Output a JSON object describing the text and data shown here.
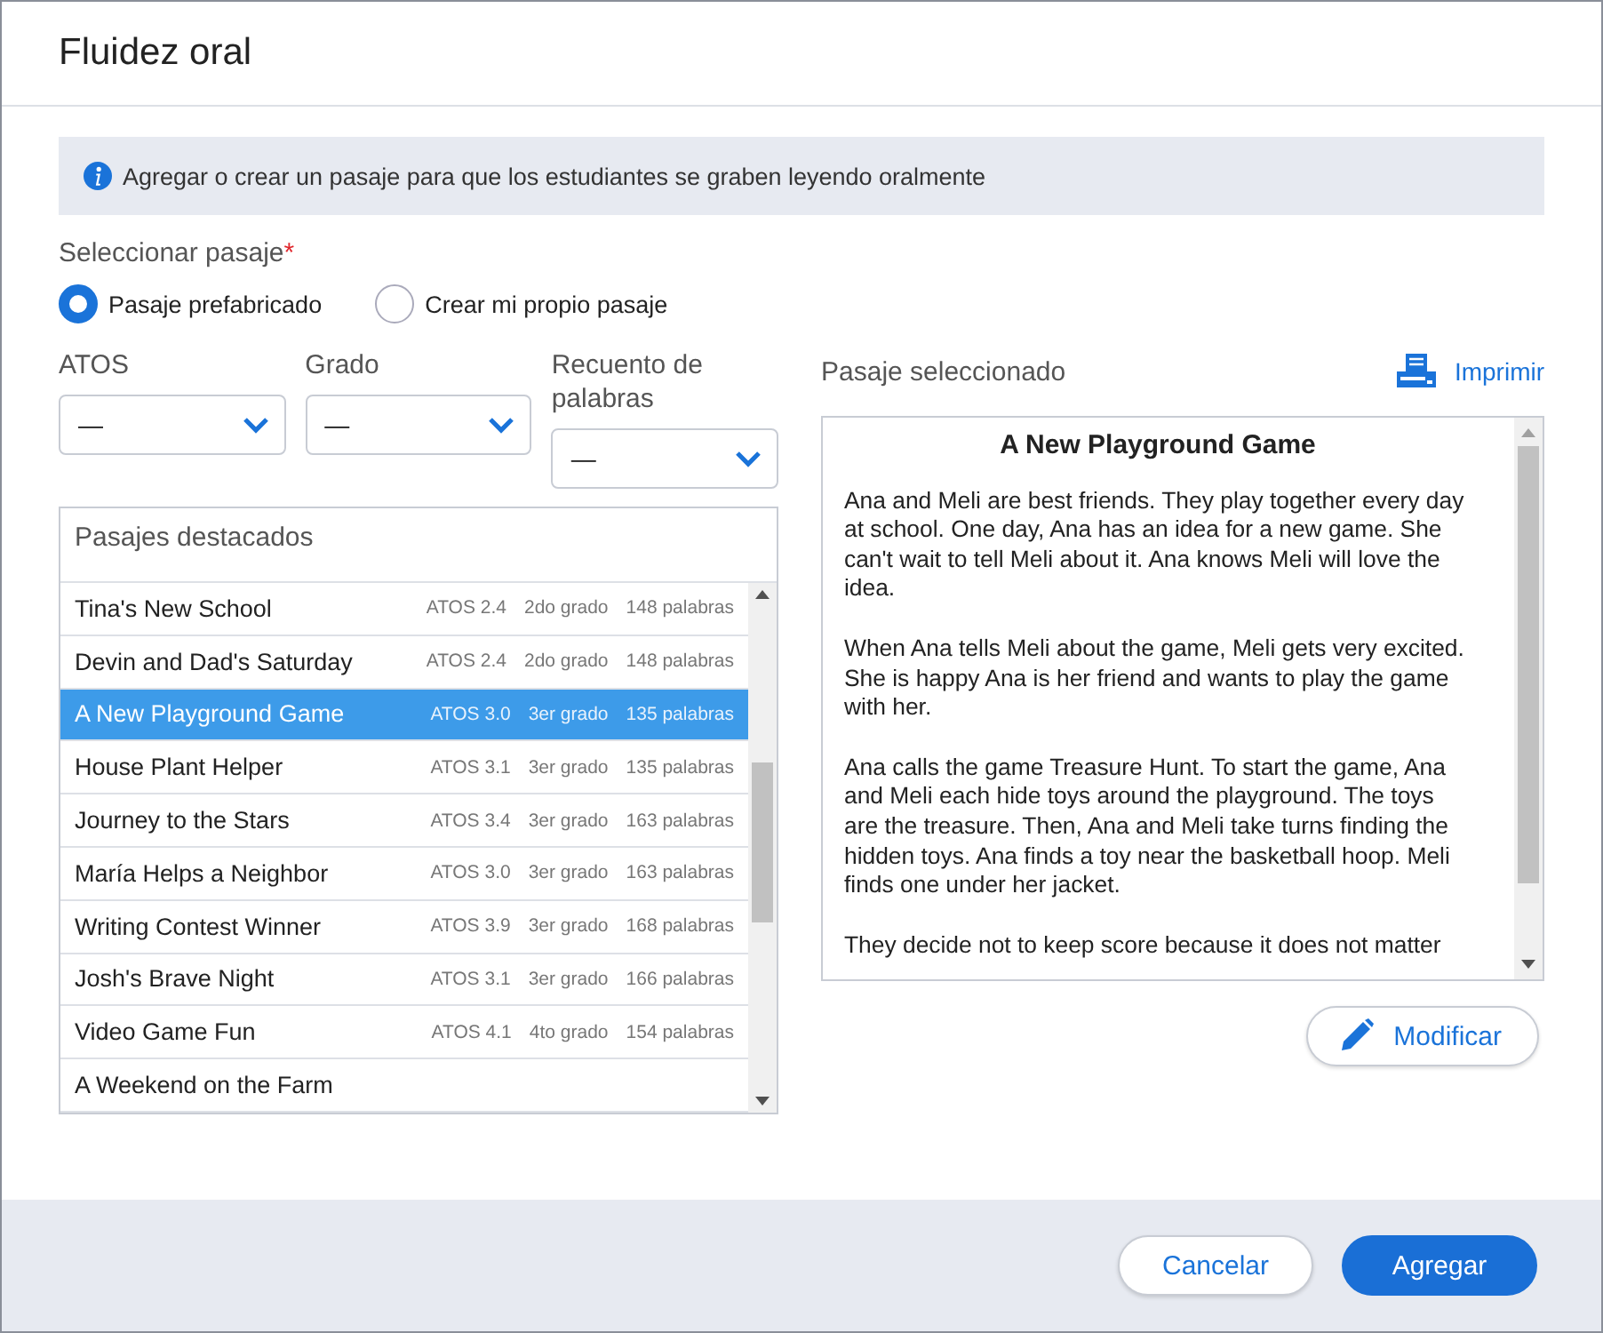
{
  "dialog": {
    "title": "Fluidez oral"
  },
  "info_banner": {
    "text": "Agregar o crear un pasaje para que los estudiantes se graben leyendo oralmente"
  },
  "passage_select": {
    "label": "Seleccionar pasaje",
    "required_mark": "*",
    "options": [
      {
        "label": "Pasaje prefabricado",
        "selected": true
      },
      {
        "label": "Crear mi propio pasaje",
        "selected": false
      }
    ]
  },
  "filters": [
    {
      "label": "ATOS",
      "value": "—"
    },
    {
      "label": "Grado",
      "value": "—"
    },
    {
      "label": "Recuento de palabras",
      "value": "—"
    }
  ],
  "featured_list": {
    "header": "Pasajes destacados",
    "rows": [
      {
        "title": "Tina's New School",
        "atos": "ATOS 2.4",
        "grade": "2do grado",
        "words": "148 palabras",
        "selected": false
      },
      {
        "title": "Devin and Dad's Saturday",
        "atos": "ATOS 2.4",
        "grade": "2do grado",
        "words": "148 palabras",
        "selected": false
      },
      {
        "title": "A New Playground Game",
        "atos": "ATOS 3.0",
        "grade": "3er grado",
        "words": "135 palabras",
        "selected": true
      },
      {
        "title": "House Plant Helper",
        "atos": "ATOS 3.1",
        "grade": "3er grado",
        "words": "135 palabras",
        "selected": false
      },
      {
        "title": "Journey to the Stars",
        "atos": "ATOS 3.4",
        "grade": "3er grado",
        "words": "163 palabras",
        "selected": false
      },
      {
        "title": "María Helps a Neighbor",
        "atos": "ATOS 3.0",
        "grade": "3er grado",
        "words": "163 palabras",
        "selected": false
      },
      {
        "title": "Writing Contest Winner",
        "atos": "ATOS 3.9",
        "grade": "3er grado",
        "words": "168 palabras",
        "selected": false
      },
      {
        "title": "Josh's Brave Night",
        "atos": "ATOS 3.1",
        "grade": "3er grado",
        "words": "166 palabras",
        "selected": false
      },
      {
        "title": "Video Game Fun",
        "atos": "ATOS 4.1",
        "grade": "4to grado",
        "words": "154 palabras",
        "selected": false
      },
      {
        "title": "A Weekend on the Farm",
        "selected": false
      }
    ]
  },
  "selected_passage": {
    "label": "Pasaje seleccionado",
    "print_link": "Imprimir",
    "title": "A New Playground Game",
    "paragraphs": [
      "Ana and Meli are best friends. They play together every day at school. One day, Ana has an idea for a new game. She can't wait to tell Meli about it. Ana knows Meli will love the idea.",
      "When Ana tells Meli about the game, Meli gets very excited.  She is happy Ana is her friend and wants to play the game with her.",
      "Ana calls the game Treasure Hunt. To start the game, Ana and Meli each hide toys around the playground. The toys are the treasure. Then, Ana and Meli take turns finding the hidden toys. Ana finds a toy near the basketball hoop. Meli finds one under her jacket.",
      "They decide not to keep score because it does not matter"
    ],
    "edit_button": "Modificar"
  },
  "footer": {
    "cancel_button": "Cancelar",
    "add_button": "Agregar"
  }
}
